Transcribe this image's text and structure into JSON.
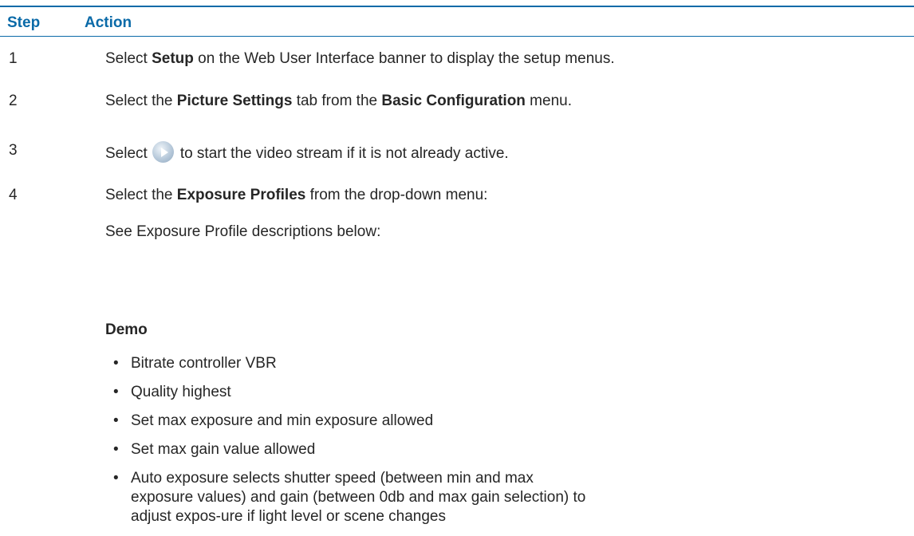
{
  "header": {
    "step": "Step",
    "action": "Action"
  },
  "steps": [
    {
      "num": "1",
      "parts": [
        "Select ",
        "Setup",
        " on the Web User Interface banner to display the setup menus."
      ]
    },
    {
      "num": "2",
      "parts": [
        "Select the ",
        "Picture Settings",
        " tab from the ",
        "Basic Configuration",
        " menu."
      ]
    },
    {
      "num": "3",
      "parts": [
        "Select",
        "to start the video stream if it is not already active."
      ],
      "icon": "play-icon"
    },
    {
      "num": "4",
      "parts": [
        "Select the ",
        "Exposure Profiles",
        " from the drop-down menu:"
      ]
    }
  ],
  "see_line": "See Exposure Profile descriptions below:",
  "demo": {
    "title": "Demo",
    "bullets": [
      "Bitrate controller VBR",
      "Quality highest",
      "Set max exposure and min exposure allowed",
      "Set max gain value allowed",
      "Auto exposure selects shutter speed (between min and max exposure values) and gain (between 0db and max gain selection) to adjust expos-ure if light level or scene changes"
    ]
  }
}
